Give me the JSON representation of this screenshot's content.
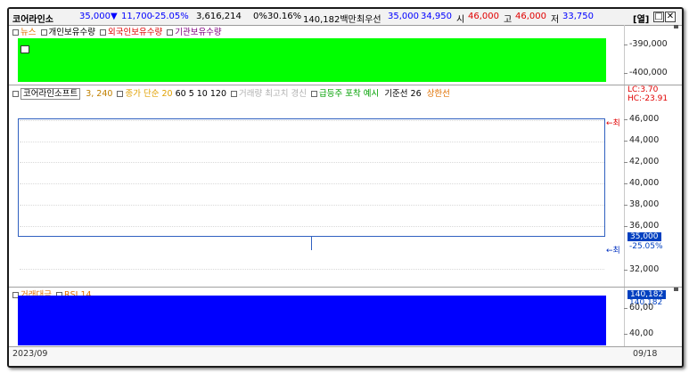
{
  "header": {
    "stock_name": "코어라인소",
    "price": "35,000",
    "arrow": "▼",
    "change": "11,700",
    "change_pct": "-25.05%",
    "volume": "3,616,214",
    "ratio_label": "0%",
    "ratio_value": "30.16%",
    "amount": "140,182백만",
    "best_quote_label": "최우선",
    "best_ask": "35,000",
    "best_bid": "34,950",
    "open_label": "시",
    "open": "46,000",
    "high_label": "고",
    "high": "46,000",
    "low_label": "저",
    "low": "33,750",
    "open_button": "[열]"
  },
  "top_panel": {
    "legend": [
      "뉴스",
      "개인보유수량",
      "외국인보유수량",
      "기관보유수량"
    ],
    "ticks": [
      "-390,000",
      "-400,000"
    ],
    "fill_color": "#00ff00"
  },
  "price_panel": {
    "legend": {
      "name": "코어라인소프트",
      "ma_label": "3, 240",
      "ma_type": "종가 단순 20",
      "ma_periods": "60  5  10  120",
      "volume_high": "거래량 최고치 경신",
      "surge": "급등주 포착 예시",
      "baseline": "기준선 26",
      "upper_limit": "상한선"
    },
    "lc_label": "LC:3.70",
    "hc_label": "HC:-23.91",
    "ticks": [
      "46,000",
      "44,000",
      "42,000",
      "40,000",
      "38,000",
      "36,000",
      "32,000"
    ],
    "current_price": "35,000",
    "current_pct": "-25.05%",
    "max_marker": "←최",
    "min_marker": "←최",
    "box_color": "#3060c0"
  },
  "volume_panel": {
    "legend": [
      "거래대금",
      "RSI 14"
    ],
    "value_badge": "140,182",
    "value_label": "140,182",
    "tick_top": "60,00",
    "tick_bottom": "40,00",
    "fill_color": "#0000ff"
  },
  "footer": {
    "start_date": "2023/09",
    "end_date": "09/18"
  }
}
